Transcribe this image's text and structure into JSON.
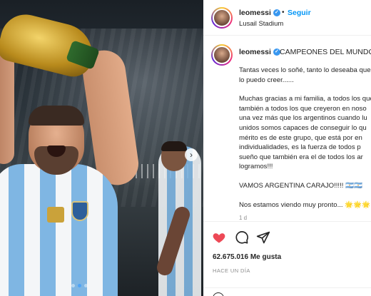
{
  "post": {
    "username": "leomessi",
    "follow_label": "Seguir",
    "separator": "•",
    "location": "Lusail Stadium"
  },
  "caption": {
    "headline": "CAMPEONES DEL MUNDO!!!",
    "lines_p1": [
      "Tantas veces lo soñé, tanto lo deseaba que",
      "lo puedo creer......"
    ],
    "lines_p2": [
      "Muchas gracias a mi familia, a todos los que",
      "también a todos los que creyeron en noso",
      "una vez más que los argentinos cuando lu",
      "unidos somos capaces de conseguir lo qu",
      "mérito es de este grupo, que está por en",
      "individualidades, es la fuerza de todos p",
      "sueño que también era el de todos los ar",
      "logramos!!!"
    ],
    "line_p3": "VAMOS ARGENTINA CARAJO!!!!! 🇦🇷🇦🇷",
    "line_p4": "Nos estamos viendo muy pronto... 🌟🌟🌟",
    "time_small": "1 d"
  },
  "engagement": {
    "likes": "62.675.016 Me gusta",
    "time_ago": "HACE UN DÍA"
  },
  "icons": {
    "heart": "heart-icon",
    "comment": "comment-icon",
    "share": "share-icon",
    "next": "chevron-right-icon",
    "verified": "verified-badge-icon",
    "emoji": "emoji-icon"
  },
  "colors": {
    "like_red": "#ed4956",
    "follow_blue": "#0095f6",
    "verified_blue": "#3897f0"
  },
  "carousel": {
    "active_index": 1,
    "count": 3
  }
}
